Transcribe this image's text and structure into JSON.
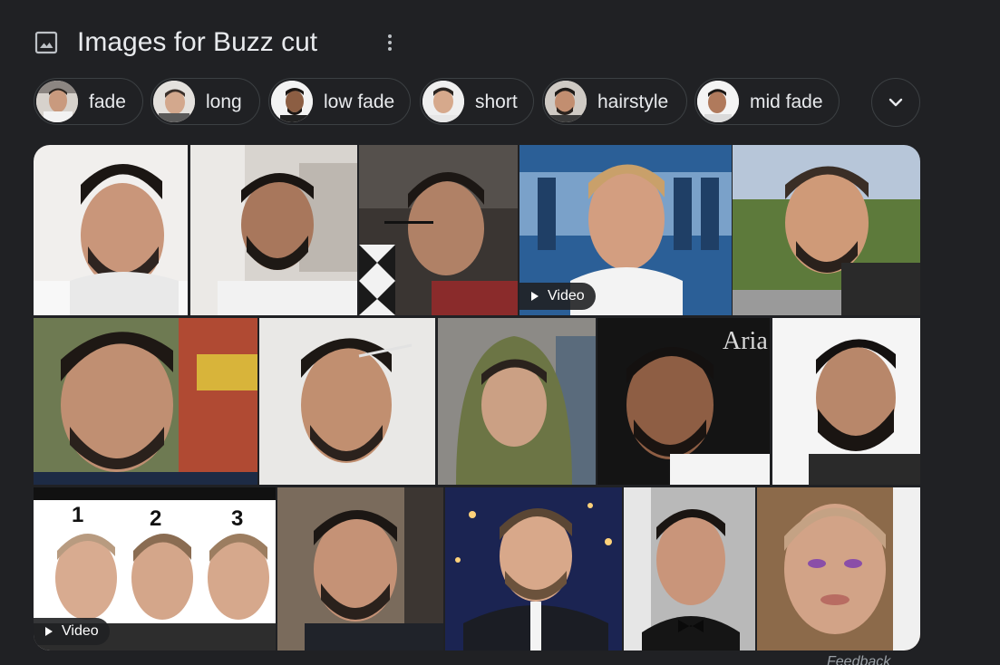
{
  "header": {
    "title": "Images for Buzz cut"
  },
  "chips": [
    {
      "label": "fade"
    },
    {
      "label": "long"
    },
    {
      "label": "low fade"
    },
    {
      "label": "short"
    },
    {
      "label": "hairstyle"
    },
    {
      "label": "mid fade"
    }
  ],
  "tiles": {
    "video_label": "Video",
    "numbers": [
      "1",
      "2",
      "3"
    ],
    "sign_text": "Aria"
  },
  "footer": {
    "feedback": "Feedback"
  },
  "colors": {
    "background": "#202124",
    "chip_border": "#3c4043",
    "text": "#e8eaed"
  }
}
